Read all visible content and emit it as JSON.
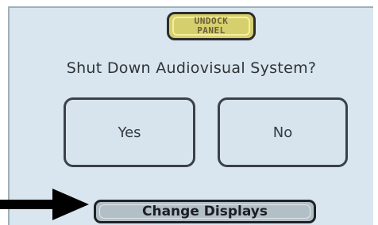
{
  "undock_button": {
    "line1": "UNDOCK",
    "line2": "PANEL"
  },
  "question": "Shut Down Audiovisual System?",
  "choices": {
    "yes": "Yes",
    "no": "No"
  },
  "change_displays_button": "Change Displays",
  "colors": {
    "screen_bg": "#d9e6ef",
    "undock_bg": "#d6cf6d",
    "button_border": "#3b4147",
    "arrow": "#000000"
  },
  "icons": {
    "pointer_arrow": "arrow-right-icon"
  }
}
